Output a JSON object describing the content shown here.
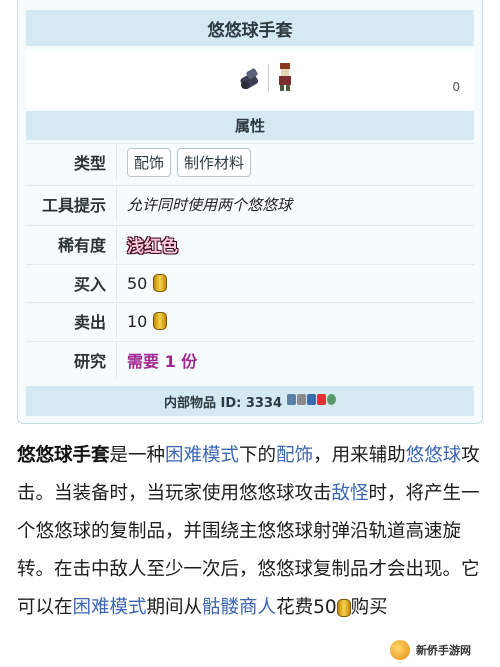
{
  "infobox": {
    "title": "悠悠球手套",
    "corner_mark": "0",
    "section_title": "属性",
    "rows": {
      "type": {
        "label": "类型",
        "tags": [
          "配饰",
          "制作材料"
        ]
      },
      "tooltip": {
        "label": "工具提示",
        "value": "允许同时使用两个悠悠球"
      },
      "rarity": {
        "label": "稀有度",
        "value": "浅红色",
        "color": "#ffc8dd"
      },
      "buy": {
        "label": "买入",
        "value": "50"
      },
      "sell": {
        "label": "卖出",
        "value": "10"
      },
      "research": {
        "label": "研究",
        "value": "需要 1 份"
      }
    },
    "id_line": "内部物品 ID: 3334"
  },
  "article": {
    "p1_bold": "悠悠球手套",
    "p1_t1": "是一种",
    "link_hardmode": "困难模式",
    "p1_t2": "下的",
    "link_accessory": "配饰",
    "p1_t3": "，用来辅助",
    "link_yoyo": "悠悠球",
    "p1_t4": "攻击。当装备时，当玩家使用悠悠球攻击",
    "link_enemy": "敌怪",
    "p1_t5": "时，将产生一个悠悠球的复制品，并围绕主悠悠球射弹沿轨道高速旋转。在击中敌人至少一次后，悠悠球复制品才会出现。它可以在",
    "link_hardmode2": "困难模式",
    "p1_t6": "期间从",
    "link_merchant": "骷髅商人",
    "p1_t7": "花费50",
    "p1_t8": "购买"
  },
  "watermark": {
    "text": "新侨手游网"
  },
  "icons": [
    "yoyo-glove-item-icon",
    "skeleton-merchant-npc-icon",
    "gold-coin-icon",
    "platform-icons"
  ]
}
